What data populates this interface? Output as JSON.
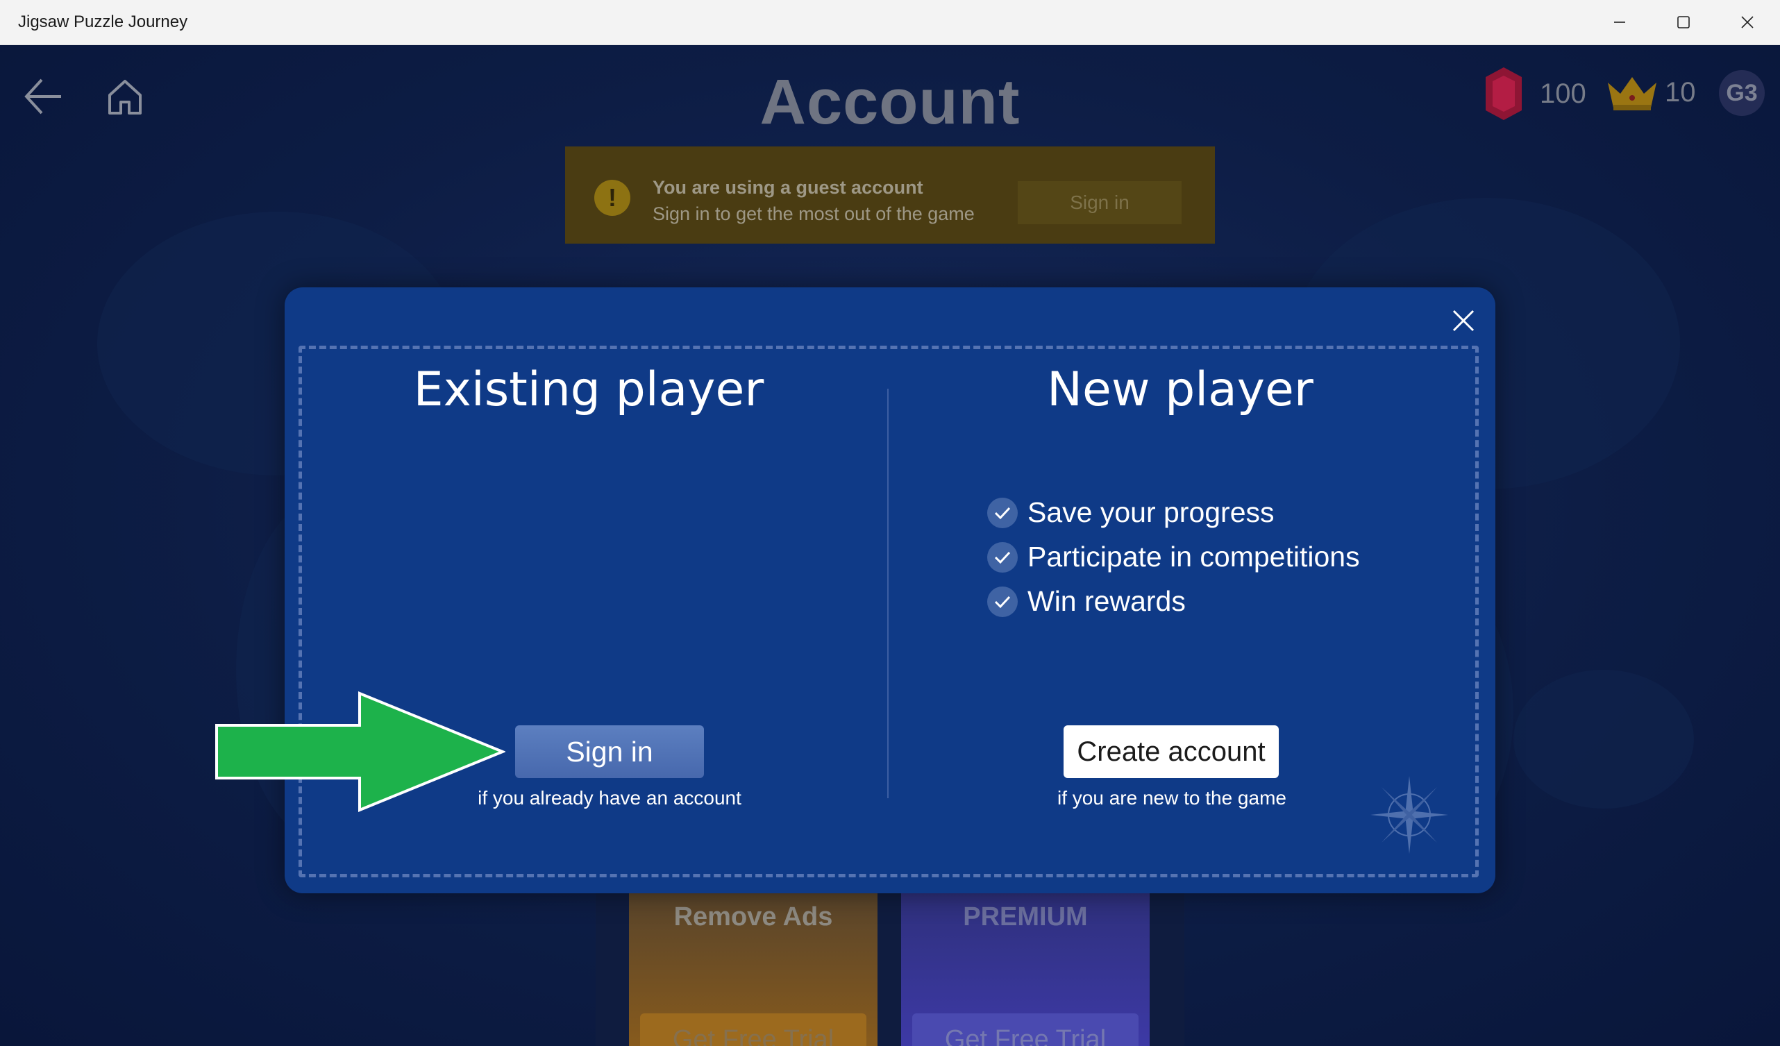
{
  "window": {
    "title": "Jigsaw Puzzle Journey"
  },
  "header": {
    "page_title": "Account",
    "gems": "100",
    "crowns": "10",
    "avatar_initials": "G3"
  },
  "guest_banner": {
    "title": "You are using a guest account",
    "subtitle": "Sign in to get the most out of the game",
    "sign_in_label": "Sign in"
  },
  "cards": [
    {
      "title": "Remove Ads",
      "button": "Get Free Trial"
    },
    {
      "title": "PREMIUM",
      "button": "Get Free Trial"
    }
  ],
  "dialog": {
    "existing": {
      "title": "Existing player",
      "button": "Sign in",
      "hint": "if you already have an account"
    },
    "new": {
      "title": "New player",
      "features": [
        "Save your progress",
        "Participate in competitions",
        "Win rewards"
      ],
      "button": "Create account",
      "hint": "if you are new to the game"
    }
  },
  "colors": {
    "modal_bg": "#0f3a87",
    "arrow": "#1db24b",
    "gem": "#c2163f",
    "crown": "#e0a51a"
  },
  "icons": [
    "back-arrow-icon",
    "home-icon",
    "gem-icon",
    "crown-icon",
    "warning-icon",
    "close-icon",
    "check-icon",
    "compass-icon"
  ]
}
